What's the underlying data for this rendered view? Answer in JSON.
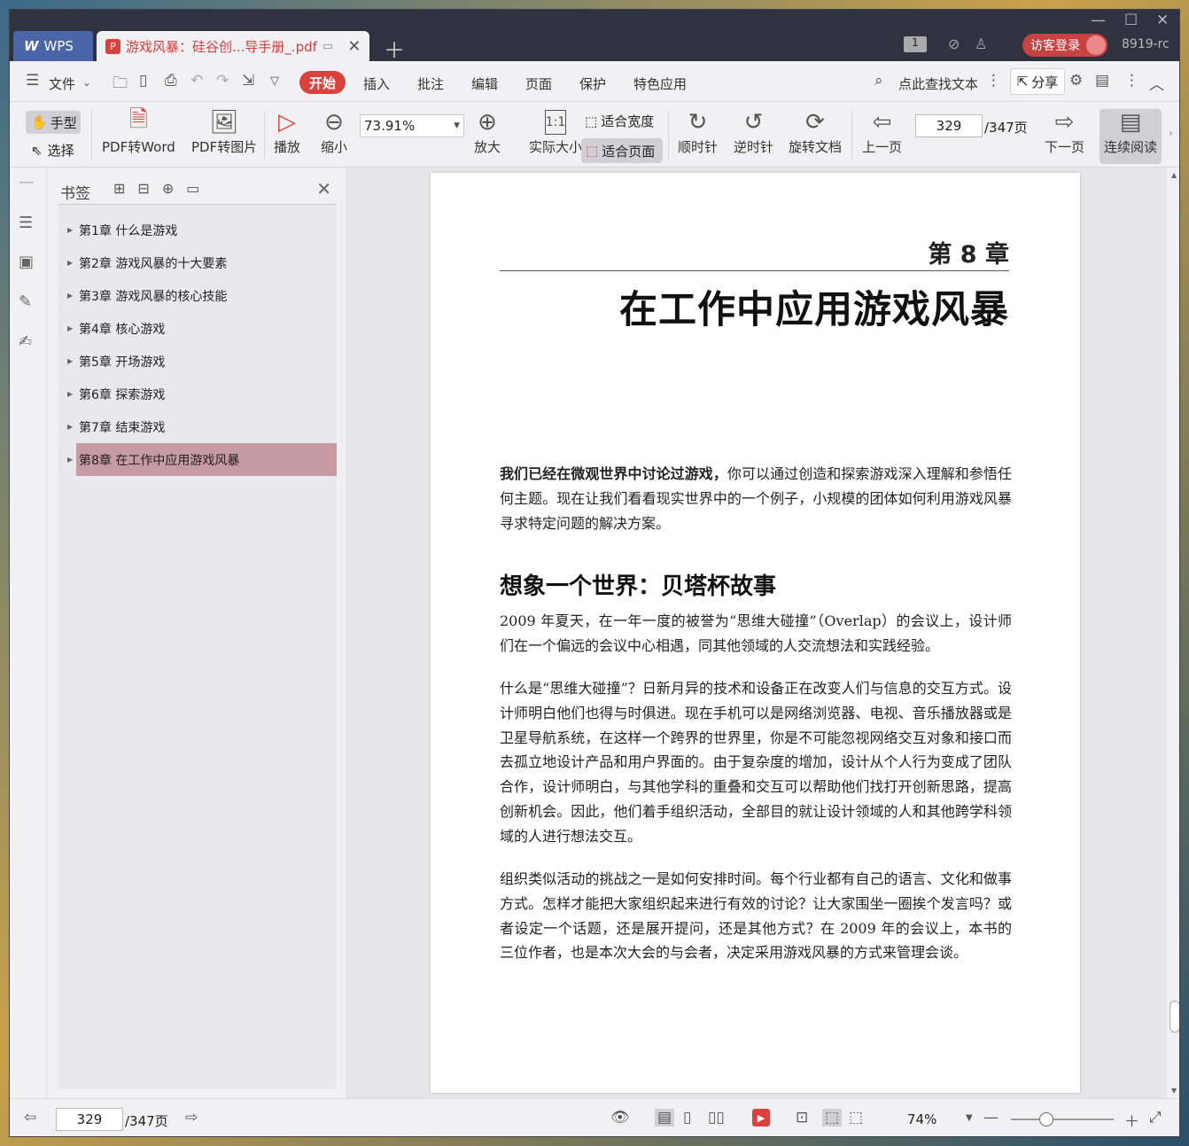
{
  "titlebar": {
    "app_tab": "WPS",
    "doc_tab": "游戏风暴：硅谷创...导手册_.pdf",
    "badge": "1",
    "login": "访客登录",
    "build": "8919-rc"
  },
  "menubar": {
    "file": "文件",
    "items": [
      "开始",
      "插入",
      "批注",
      "编辑",
      "页面",
      "保护",
      "特色应用"
    ],
    "search": "点此查找文本",
    "share": "分享"
  },
  "toolbar": {
    "hand": "手型",
    "select": "选择",
    "pdf_to_word": "PDF转Word",
    "pdf_to_image": "PDF转图片",
    "play": "播放",
    "zoom_out": "缩小",
    "zoom_value": "73.91%",
    "zoom_in": "放大",
    "actual_size": "实际大小",
    "fit_width": "适合宽度",
    "fit_page": "适合页面",
    "clockwise": "顺时针",
    "counterclockwise": "逆时针",
    "rotate_doc": "旋转文档",
    "prev_page": "上一页",
    "page_current": "329",
    "page_total": "/347页",
    "next_page": "下一页",
    "continuous": "连续阅读"
  },
  "bookmarks": {
    "title": "书签",
    "items": [
      "第1章 什么是游戏",
      "第2章 游戏风暴的十大要素",
      "第3章 游戏风暴的核心技能",
      "第4章 核心游戏",
      "第5章 开场游戏",
      "第6章 探索游戏",
      "第7章 结束游戏",
      "第8章 在工作中应用游戏风暴"
    ],
    "selected_index": 7
  },
  "page": {
    "chapter_number": "第 8 章",
    "chapter_title": "在工作中应用游戏风暴",
    "intro_bold": "我们已经在微观世界中讨论过游戏，",
    "intro_rest": "你可以通过创造和探索游戏深入理解和参悟任何主题。现在让我们看看现实世界中的一个例子，小规模的团体如何利用游戏风暴寻求特定问题的解决方案。",
    "section_heading": "想象一个世界：贝塔杯故事",
    "p1": "2009 年夏天，在一年一度的被誉为“思维大碰撞”（Overlap）的会议上，设计师们在一个偏远的会议中心相遇，同其他领域的人交流想法和实践经验。",
    "p2": "什么是“思维大碰撞”？日新月异的技术和设备正在改变人们与信息的交互方式。设计师明白他们也得与时俱进。现在手机可以是网络浏览器、电视、音乐播放器或是卫星导航系统，在这样一个跨界的世界里，你是不可能忽视网络交互对象和接口而去孤立地设计产品和用户界面的。由于复杂度的增加，设计从个人行为变成了团队合作，设计师明白，与其他学科的重叠和交互可以帮助他们找打开创新思路，提高创新机会。因此，他们着手组织活动，全部目的就让设计领域的人和其他跨学科领域的人进行想法交互。",
    "p3": "组织类似活动的挑战之一是如何安排时间。每个行业都有自己的语言、文化和做事方式。怎样才能把大家组织起来进行有效的讨论？让大家围坐一圈挨个发言吗？或者设定一个话题，还是展开提问，还是其他方式？在 2009 年的会议上，本书的三位作者，也是本次大会的与会者，决定采用游戏风暴的方式来管理会谈。"
  },
  "statusbar": {
    "page_current": "329",
    "page_total": "/347页",
    "zoom": "74%"
  },
  "colors": {
    "accent": "#d9433e",
    "bookmark_selected": "#c79ba2",
    "titlebar": "#2f3340"
  }
}
